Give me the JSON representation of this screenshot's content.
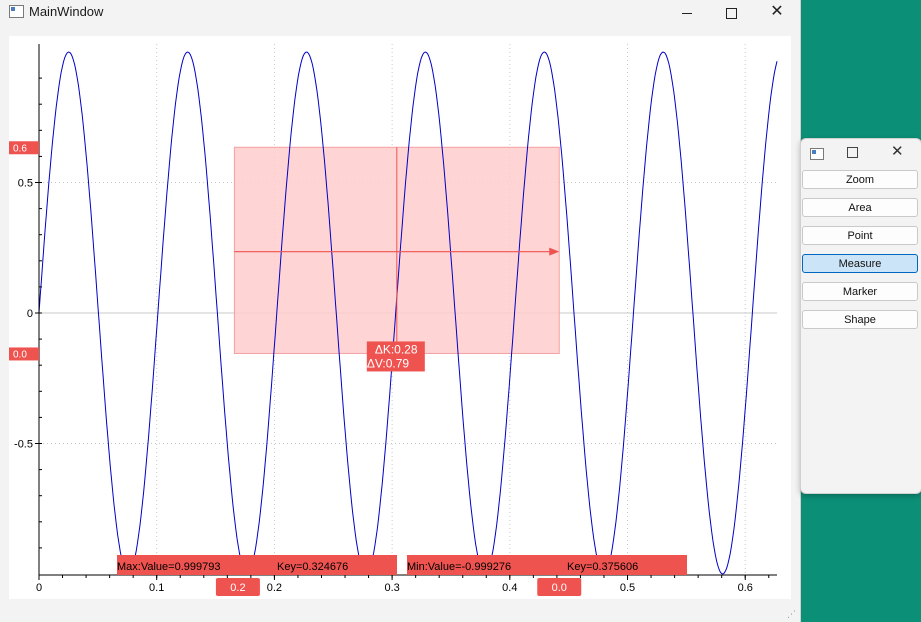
{
  "window": {
    "title": "MainWindow",
    "minimize_label": "",
    "maximize_label": "",
    "close_label": "✕"
  },
  "chart_data": {
    "type": "line",
    "x_ticks": [
      "0",
      "0.1",
      "0.2",
      "0.3",
      "0.4",
      "0.5",
      "0.6"
    ],
    "y_ticks": [
      "0.5",
      "0",
      "-0.5"
    ],
    "xlim": [
      0,
      0.627
    ],
    "ylim": [
      -1.0,
      1.0
    ],
    "series": [
      {
        "function": "sin(2*pi*9.9*x)",
        "x_start": 0,
        "x_end": 0.627,
        "color": "#0000c8"
      }
    ],
    "grid": true,
    "measure": {
      "x1": 0.166,
      "x2": 0.442,
      "y1": 0.635,
      "y2": -0.155,
      "cursor_x": 0.304,
      "arrow_y": 0.235,
      "dk_label": "ΔK:0.28",
      "dv_label": "ΔV:0.79"
    },
    "y_markers": [
      {
        "label": "0.6",
        "value": 0.635
      },
      {
        "label": "0.0",
        "value": -0.155
      }
    ],
    "x_markers": [
      {
        "label": "0.2",
        "value": 0.169
      },
      {
        "label": "0.0",
        "value": 0.442
      }
    ],
    "max_info": {
      "label": "Max:Value=0.999793",
      "key_label": "Key=0.324676"
    },
    "min_info": {
      "label": "Min:Value=-0.999276",
      "key_label": "Key=0.375606"
    }
  },
  "tool_panel": {
    "close_label": "✕",
    "buttons": [
      "Zoom",
      "Area",
      "Point",
      "Measure",
      "Marker",
      "Shape"
    ],
    "active": "Measure"
  },
  "colors": {
    "line": "#0000c8",
    "accent": "#ef5350",
    "region": "#ffcccc"
  }
}
